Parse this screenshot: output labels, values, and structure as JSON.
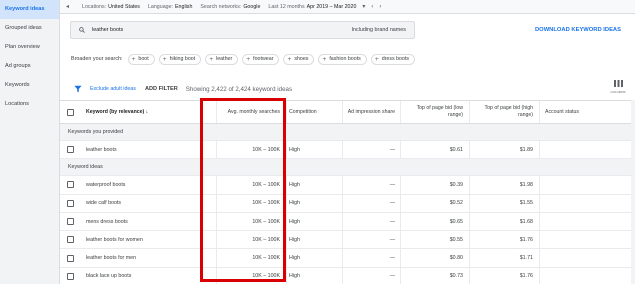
{
  "sidebar": {
    "items": [
      {
        "label": "Keyword ideas",
        "active": true
      },
      {
        "label": "Grouped ideas",
        "active": false
      },
      {
        "label": "Plan overview",
        "active": false
      },
      {
        "label": "Ad groups",
        "active": false
      },
      {
        "label": "Keywords",
        "active": false
      },
      {
        "label": "Locations",
        "active": false
      }
    ]
  },
  "topbar": {
    "locations_label": "Locations:",
    "locations_value": "United States",
    "language_label": "Language:",
    "language_value": "English",
    "networks_label": "Search networks:",
    "networks_value": "Google",
    "range_label": "Last 12 months",
    "range_value": "Apr 2019 – Mar 2020"
  },
  "search": {
    "query": "leather boots",
    "brand_names": "Including brand names",
    "download": "DOWNLOAD KEYWORD IDEAS"
  },
  "broaden": {
    "label": "Broaden your search:",
    "chips": [
      "boot",
      "hiking boot",
      "leather",
      "footwear",
      "shoes",
      "fashion boots",
      "dress boots"
    ]
  },
  "toolbar": {
    "exclude": "Exclude adult ideas",
    "add_filter": "ADD FILTER",
    "showing": "Showing 2,422 of 2,424 keyword ideas",
    "columns": "COLUMNS"
  },
  "table": {
    "headers": {
      "keyword": "Keyword (by relevance) ↓",
      "volume": "Avg. monthly searches",
      "competition": "Competition",
      "impression": "Ad impression share",
      "low_bid": "Top of page bid (low range)",
      "high_bid": "Top of page bid (high range)",
      "status": "Account status"
    },
    "provided_label": "Keywords you provided",
    "provided_rows": [
      {
        "keyword": "leather boots",
        "volume": "10K – 100K",
        "competition": "High",
        "impression": "—",
        "low": "$0.61",
        "high": "$1.89"
      }
    ],
    "ideas_label": "Keyword ideas",
    "idea_rows": [
      {
        "keyword": "waterproof boots",
        "volume": "10K – 100K",
        "competition": "High",
        "impression": "—",
        "low": "$0.39",
        "high": "$1.98"
      },
      {
        "keyword": "wide calf boots",
        "volume": "10K – 100K",
        "competition": "High",
        "impression": "—",
        "low": "$0.52",
        "high": "$1.55"
      },
      {
        "keyword": "mens dress boots",
        "volume": "10K – 100K",
        "competition": "High",
        "impression": "—",
        "low": "$0.65",
        "high": "$1.68"
      },
      {
        "keyword": "leather boots for women",
        "volume": "10K – 100K",
        "competition": "High",
        "impression": "—",
        "low": "$0.55",
        "high": "$1.76"
      },
      {
        "keyword": "leather boots for men",
        "volume": "10K – 100K",
        "competition": "High",
        "impression": "—",
        "low": "$0.80",
        "high": "$1.71"
      },
      {
        "keyword": "black lace up boots",
        "volume": "10K – 100K",
        "competition": "High",
        "impression": "—",
        "low": "$0.73",
        "high": "$1.76"
      }
    ]
  }
}
